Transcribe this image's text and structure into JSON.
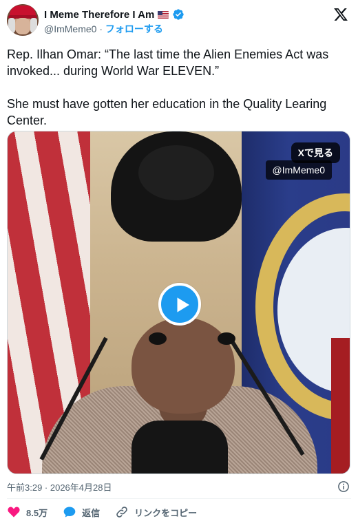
{
  "author": {
    "display_name": "I Meme Therefore I Am",
    "handle": "@ImMeme0",
    "separator": " · ",
    "follow_label": "フォローする",
    "verified": true
  },
  "tweet": {
    "text": "Rep. Ilhan Omar: “The last time the Alien Enemies Act was invoked... during World War ELEVEN.”\n\nShe must have gotten her education in the Quality Learing Center."
  },
  "media": {
    "see_on_x_label": "Xで見る",
    "watermark": "@ImMeme0",
    "play_icon": "play-icon"
  },
  "timestamp": "午前3:29 · 2026年4月28日",
  "actions": {
    "like_count": "8.5万",
    "reply_label": "返信",
    "copy_link_label": "リンクをコピー"
  },
  "colors": {
    "accent": "#1d9bf0",
    "like": "#f91880",
    "text": "#0f1419",
    "secondary": "#536471"
  },
  "icons": {
    "verified": "verified-icon",
    "flag": "us-flag-icon",
    "logo": "x-logo-icon",
    "info": "info-icon",
    "like": "heart-icon",
    "reply": "reply-bubble-icon",
    "link": "link-icon"
  }
}
